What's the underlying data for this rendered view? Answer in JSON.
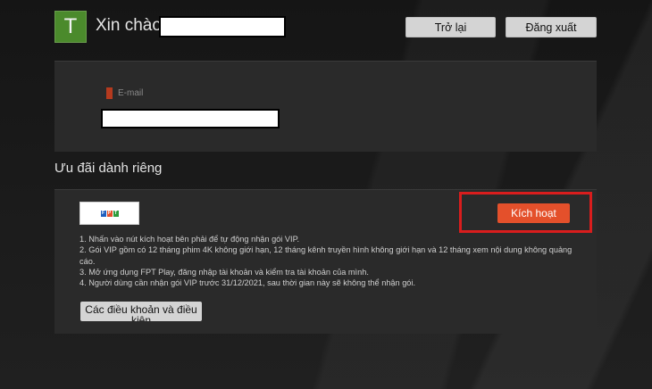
{
  "header": {
    "avatar_letter": "T",
    "greeting": "Xin chào,",
    "back_label": "Trở lại",
    "logout_label": "Đăng xuất"
  },
  "account": {
    "email_label": "E-mail"
  },
  "offer": {
    "section_title": "Ưu đãi dành riêng",
    "activate_label": "Kích hoạt",
    "terms": [
      "1. Nhấn vào nút kích hoạt bên phải để tự động nhận gói VIP.",
      "2. Gói VIP gồm có 12 tháng phim 4K không giới hạn, 12 tháng kênh truyền hình không giới hạn và 12 tháng xem nội dung không quảng cáo.",
      "3. Mở ứng dụng FPT Play, đăng nhập tài khoản và kiểm tra tài khoản của mình.",
      "4. Người dùng cần nhận gói VIP trước 31/12/2021, sau thời gian này sẽ không thể nhận gói."
    ],
    "terms_button_label": "Các điều khoản và điều kiện",
    "logo_letters": [
      "F",
      "P",
      "T"
    ],
    "logo_colors": [
      "#1f5fbf",
      "#e4502b",
      "#2e9b3a"
    ]
  },
  "colors": {
    "accent": "#e4502b",
    "highlight_border": "#d91d1d",
    "avatar_bg": "#4b8a2c"
  }
}
